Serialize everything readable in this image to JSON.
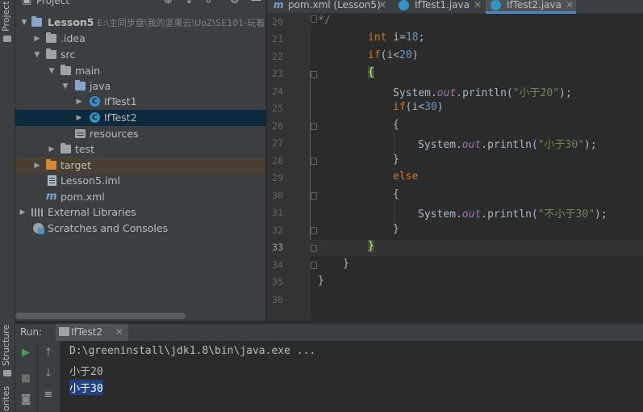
{
  "side_tabs": {
    "project": "Project",
    "structure": "Structure",
    "favorites": "orites"
  },
  "project_panel": {
    "title": "Project",
    "tree": [
      {
        "label": "Lesson5",
        "path": "E:\\主同步盘\\我的坚果云\\UoZ\\SE101-玩着",
        "icon": "folder-blue-icon",
        "level": 0,
        "expanded": true
      },
      {
        "label": ".idea",
        "icon": "folder-grey-icon",
        "level": 1,
        "expanded": false
      },
      {
        "label": "src",
        "icon": "folder-grey-icon",
        "level": 1,
        "expanded": true
      },
      {
        "label": "main",
        "icon": "folder-grey-icon",
        "level": 2,
        "expanded": true
      },
      {
        "label": "java",
        "icon": "folder-blue-icon",
        "level": 3,
        "expanded": true
      },
      {
        "label": "IfTest1",
        "icon": "java-class-icon",
        "level": 4,
        "expanded": false
      },
      {
        "label": "IfTest2",
        "icon": "java-class-icon",
        "level": 4,
        "expanded": false,
        "selected": true
      },
      {
        "label": "resources",
        "icon": "resources-folder-icon",
        "level": 3
      },
      {
        "label": "test",
        "icon": "folder-grey-icon",
        "level": 2,
        "expanded": false
      },
      {
        "label": "target",
        "icon": "folder-orange-icon",
        "level": 1,
        "expanded": false
      },
      {
        "label": "Lesson5.iml",
        "icon": "iml-file-icon",
        "level": 1
      },
      {
        "label": "pom.xml",
        "icon": "maven-icon",
        "level": 1
      },
      {
        "label": "External Libraries",
        "icon": "libraries-icon",
        "level": 0,
        "expanded": false
      },
      {
        "label": "Scratches and Consoles",
        "icon": "scratches-icon",
        "level": 0
      }
    ]
  },
  "tabs": [
    {
      "label": "pom.xml (Lesson5)",
      "icon": "maven-icon",
      "active": false
    },
    {
      "label": "IfTest1.java",
      "icon": "java-class-icon",
      "active": false
    },
    {
      "label": "IfTest2.java",
      "icon": "java-class-icon",
      "active": true
    }
  ],
  "editor": {
    "current_line": "33",
    "lines": [
      {
        "n": "20",
        "text": "*/"
      },
      {
        "n": "21",
        "text": "int i=18;"
      },
      {
        "n": "22",
        "text": "if(i<20)"
      },
      {
        "n": "23",
        "text": "{"
      },
      {
        "n": "24",
        "text": "System.out.println(\"小于20\");"
      },
      {
        "n": "25",
        "text": "if(i<30)"
      },
      {
        "n": "26",
        "text": "{"
      },
      {
        "n": "27",
        "text": "System.out.println(\"小于30\");"
      },
      {
        "n": "28",
        "text": "}"
      },
      {
        "n": "29",
        "text": "else"
      },
      {
        "n": "30",
        "text": "{"
      },
      {
        "n": "31",
        "text": "System.out.println(\"不小于30\");"
      },
      {
        "n": "32",
        "text": "}"
      },
      {
        "n": "33",
        "text": "}"
      },
      {
        "n": "34",
        "text": "}"
      },
      {
        "n": "35",
        "text": "}"
      },
      {
        "n": "36",
        "text": ""
      }
    ]
  },
  "run_panel": {
    "label": "Run:",
    "tab_label": "IfTest2",
    "console": [
      {
        "text": "D:\\greeninstall\\jdk1.8\\bin\\java.exe ...",
        "selected": false
      },
      {
        "text": "小于20",
        "selected": false
      },
      {
        "text": "小于30",
        "selected": true
      }
    ]
  },
  "colors": {
    "accent": "#4a88c7",
    "selection": "#0d293e",
    "keyword": "#cc7832",
    "number": "#6897bb",
    "string": "#6a8759",
    "field": "#9876aa"
  }
}
